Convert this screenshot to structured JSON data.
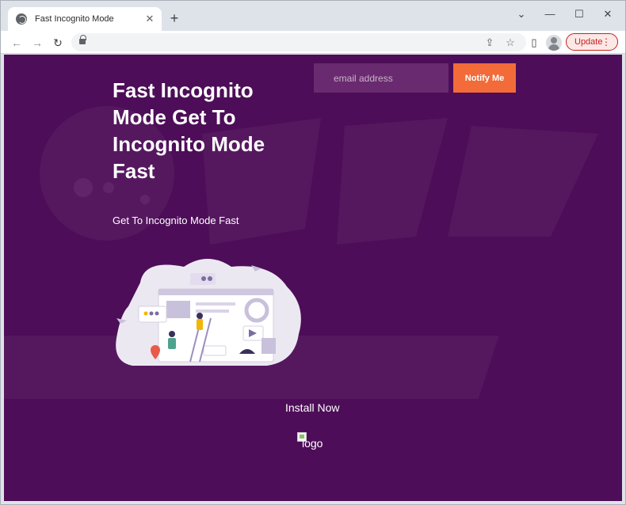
{
  "browser": {
    "tab_title": "Fast Incognito Mode",
    "tab_close": "✕",
    "new_tab": "+",
    "window_controls": {
      "dropdown": "⌄",
      "minimize": "—",
      "maximize": "☐",
      "close": "✕"
    },
    "nav": {
      "back": "←",
      "forward": "→",
      "reload": "↻"
    },
    "omnibox_icons": {
      "share": "⇪",
      "bookmark": "☆"
    },
    "toolbar_icons": {
      "sidepanel": "▯"
    },
    "update_label": "Update",
    "menu_dots": "⋮"
  },
  "page": {
    "headline": "Fast Incognito Mode Get To Incognito Mode Fast",
    "subline": "Get To Incognito Mode Fast",
    "email_placeholder": "email address",
    "notify_label": "Notify Me",
    "install_label": "Install Now",
    "logo_alt": "logo",
    "colors": {
      "background": "#4d0d58",
      "input": "#6a2a6f",
      "accent": "#f26b38"
    }
  }
}
